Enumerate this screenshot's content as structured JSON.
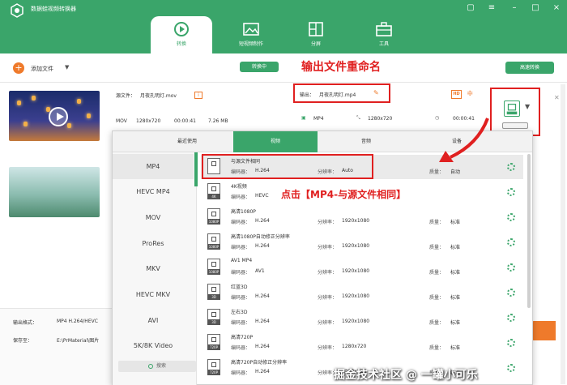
{
  "app": {
    "title": "数据蛙视频转换器"
  },
  "colors": {
    "accent": "#3aa56a",
    "orange": "#ef7a2b",
    "annotation_red": "#e02020"
  },
  "nav": [
    {
      "label": "转换",
      "icon": "convert-icon"
    },
    {
      "label": "短视频制作",
      "icon": "image-icon"
    },
    {
      "label": "分屏",
      "icon": "split-screen-icon"
    },
    {
      "label": "工具",
      "icon": "toolbox-icon"
    }
  ],
  "toolbar": {
    "add_file": "添加文件",
    "converting_tab": "转换中",
    "fast_convert": "高速转换"
  },
  "file": {
    "source_label": "源文件：",
    "source_name": "月夜孔明灯.mov",
    "format": "MOV",
    "resolution": "1280x720",
    "duration": "00:00:41",
    "size": "7.26 MB",
    "output_label": "输出：",
    "output_name": "月夜孔明灯.mp4",
    "out_format": "MP4",
    "out_resolution": "1280x720",
    "out_duration": "00:00:41"
  },
  "annotations": {
    "rename": "输出文件重命名",
    "click": "点击【MP4-与源文件相同】",
    "watermark": "掘金技术社区 @ 一罐小可乐"
  },
  "format_panel": {
    "tabs": [
      "最近使用",
      "视频",
      "音频",
      "设备"
    ],
    "categories": [
      "MP4",
      "HEVC MP4",
      "MOV",
      "ProRes",
      "MKV",
      "HEVC MKV",
      "AVI",
      "5K/8K Video"
    ],
    "search": "搜索",
    "labels": {
      "encoder": "编码器：",
      "resolution": "分辨率：",
      "quality": "质量："
    },
    "presets": [
      {
        "name": "与源文件相同",
        "encoder": "H.264",
        "resolution": "Auto",
        "quality": "自动",
        "tag": ""
      },
      {
        "name": "4K视频",
        "encoder": "HEVC",
        "resolution": "",
        "quality": "",
        "tag": "4K"
      },
      {
        "name": "高清1080P",
        "encoder": "H.264",
        "resolution": "1920x1080",
        "quality": "标准",
        "tag": "1080P"
      },
      {
        "name": "高清1080P自动修正分辨率",
        "encoder": "H.264",
        "resolution": "1920x1080",
        "quality": "标准",
        "tag": "1080P"
      },
      {
        "name": "AV1 MP4",
        "encoder": "AV1",
        "resolution": "1920x1080",
        "quality": "标准",
        "tag": "1080P"
      },
      {
        "name": "红蓝3D",
        "encoder": "H.264",
        "resolution": "1920x1080",
        "quality": "标准",
        "tag": "3D"
      },
      {
        "name": "左右3D",
        "encoder": "H.264",
        "resolution": "1920x1080",
        "quality": "标准",
        "tag": "3D"
      },
      {
        "name": "高清720P",
        "encoder": "H.264",
        "resolution": "1280x720",
        "quality": "标准",
        "tag": "720P"
      },
      {
        "name": "高清720P自动修正分辨率",
        "encoder": "H.264",
        "resolution": "1280x720",
        "quality": "标准",
        "tag": "720P"
      }
    ]
  },
  "bottom": {
    "output_format_label": "输出格式：",
    "output_format_value": "MP4 H.264/HEVC",
    "save_label": "保存至：",
    "save_value": "E:\\PrMaterial\\图片"
  }
}
